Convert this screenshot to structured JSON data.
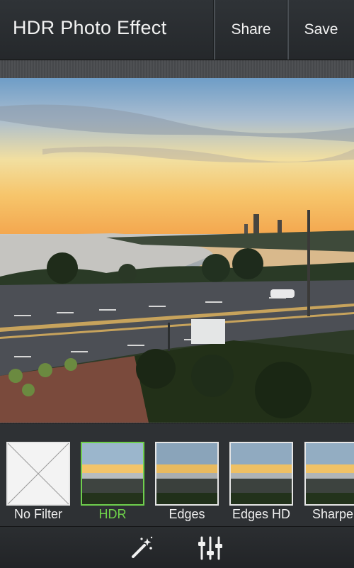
{
  "header": {
    "title": "HDR Photo Effect",
    "share_label": "Share",
    "save_label": "Save"
  },
  "filters": [
    {
      "label": "No Filter",
      "selected": false
    },
    {
      "label": "HDR",
      "selected": true
    },
    {
      "label": "Edges",
      "selected": false
    },
    {
      "label": "Edges HD",
      "selected": false
    },
    {
      "label": "Sharpen",
      "selected": false
    }
  ],
  "toolbar": {
    "icons": [
      "magic-wand-icon",
      "sliders-icon"
    ]
  },
  "colors": {
    "selected_accent": "#6fd34a",
    "bar_background": "#2e3134"
  }
}
